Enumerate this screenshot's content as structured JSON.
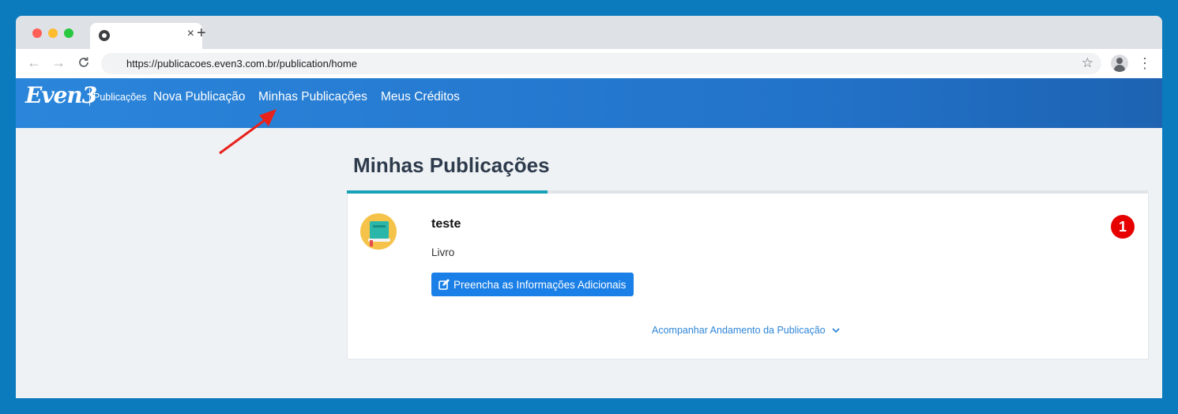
{
  "browser": {
    "tab_close": "×",
    "new_tab": "+",
    "back": "←",
    "forward": "→",
    "reload": "C",
    "url": "https://publicacoes.even3.com.br/publication/home",
    "bookmark_icon": "star-icon",
    "menu": "⋮",
    "traffic_lights": [
      "#ff5f57",
      "#febc2e",
      "#28c840"
    ]
  },
  "site": {
    "logo": "Even3",
    "logo_sub": "Publicações",
    "nav": [
      "Nova Publicação",
      "Minhas Publicações",
      "Meus Créditos"
    ],
    "accent": "#2272c9"
  },
  "main": {
    "title": "Minhas Publicações",
    "publication": {
      "title": "teste",
      "type": "Livro",
      "button_label": "Preencha as Informações Adicionais",
      "track_label": "Acompanhar Andamento da Publicação"
    },
    "badge": "1",
    "tab_accent": "#17a2b8"
  }
}
